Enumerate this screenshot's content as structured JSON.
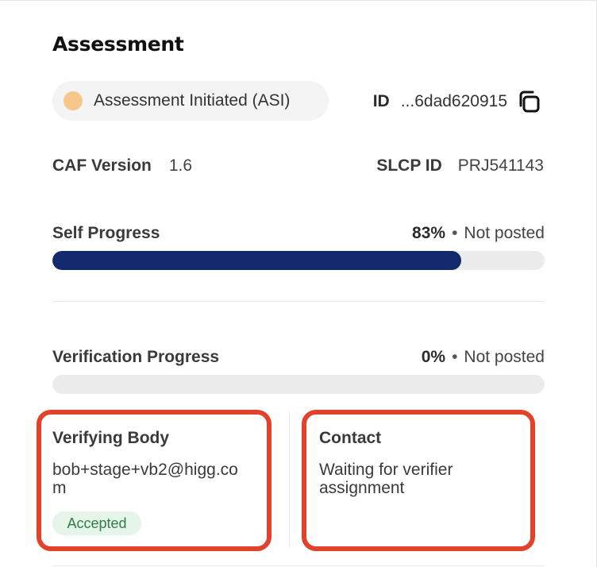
{
  "title": "Assessment",
  "status": {
    "label": "Assessment Initiated (ASI)",
    "dot_color": "#f7c68a"
  },
  "id": {
    "label": "ID",
    "value": "...6dad620915",
    "copy_icon": "copy-icon"
  },
  "caf": {
    "label": "CAF Version",
    "value": "1.6"
  },
  "slcp": {
    "label": "SLCP ID",
    "value": "PRJ541143"
  },
  "self_progress": {
    "label": "Self Progress",
    "percent_text": "83%",
    "separator": "•",
    "state": "Not posted",
    "fraction": 0.83,
    "fill_color": "#12296b"
  },
  "verification_progress": {
    "label": "Verification Progress",
    "percent_text": "0%",
    "separator": "•",
    "state": "Not posted",
    "fraction": 0
  },
  "verifying_body": {
    "heading": "Verifying Body",
    "email_line1": "bob+stage+vb2@higg.co",
    "email_line2": "m",
    "badge": "Accepted"
  },
  "contact": {
    "heading": "Contact",
    "line1": "Waiting for verifier",
    "line2": "assignment"
  },
  "highlight_color": "#e2412b"
}
